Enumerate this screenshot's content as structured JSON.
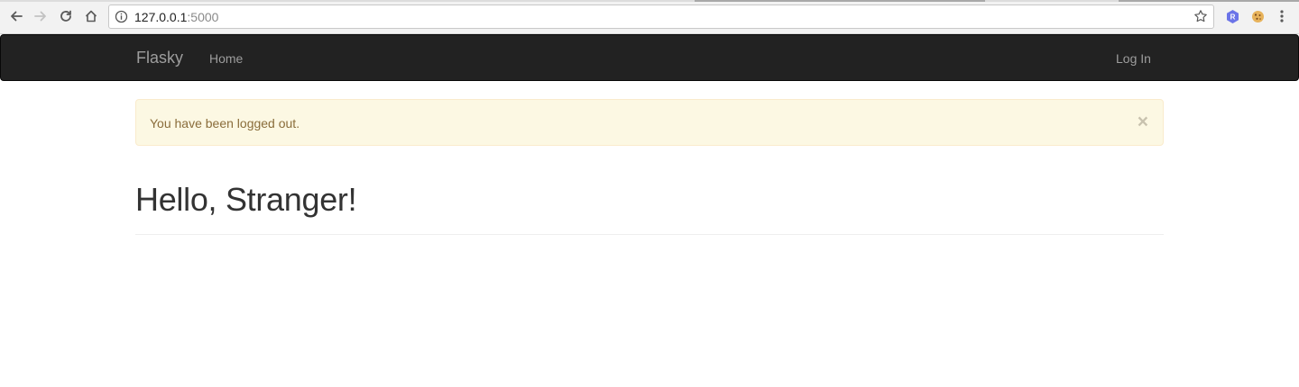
{
  "browser": {
    "url_host": "127.0.0.1",
    "url_port": ":5000",
    "icons": {
      "back": "back-arrow-icon",
      "forward": "forward-arrow-icon",
      "reload": "reload-icon",
      "home": "home-icon",
      "info": "info-icon",
      "bookmark": "star-icon",
      "extension1": "hexagon-r-icon",
      "extension2": "cookie-icon",
      "menu": "kebab-menu-icon"
    }
  },
  "navbar": {
    "brand": "Flasky",
    "home": "Home",
    "login": "Log In"
  },
  "alert": {
    "message": "You have been logged out.",
    "close": "×"
  },
  "page": {
    "heading": "Hello, Stranger!"
  },
  "colors": {
    "navbar_bg": "#222222",
    "navbar_text": "#9d9d9d",
    "alert_bg": "#fcf8e3",
    "alert_border": "#faebcc",
    "alert_text": "#8a6d3b",
    "heading_text": "#333333"
  }
}
